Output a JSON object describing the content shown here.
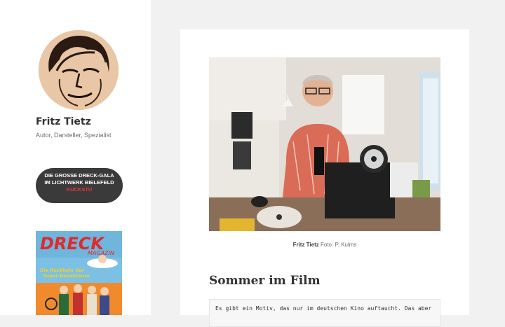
{
  "sidebar": {
    "site_title": "Fritz Tietz",
    "site_description": "Autor, Darsteller, Spezialist",
    "gala_button": {
      "text": "DIE GROSSE DRECK-GALA IM LICHTWERK BIELEFELD ",
      "accent": "KUCKSTU"
    },
    "magazine": {
      "title": "DRECK",
      "subtitle": "MAGAZIN",
      "headline_1": "Die Rückkehr der",
      "headline_2": "Super-Redakteure"
    }
  },
  "main": {
    "photo_caption_name": "Fritz Tietz",
    "photo_caption_credit": "Foto: P. Kulms",
    "post_title": "Sommer im Film",
    "post_excerpt": "Es gibt ein Motiv, das nur im deutschen Kino auftaucht. Das aber"
  },
  "colors": {
    "page_background": "#f1f1f1",
    "gala_button_background": "#3a3a3a",
    "gala_accent": "#e8383d"
  }
}
